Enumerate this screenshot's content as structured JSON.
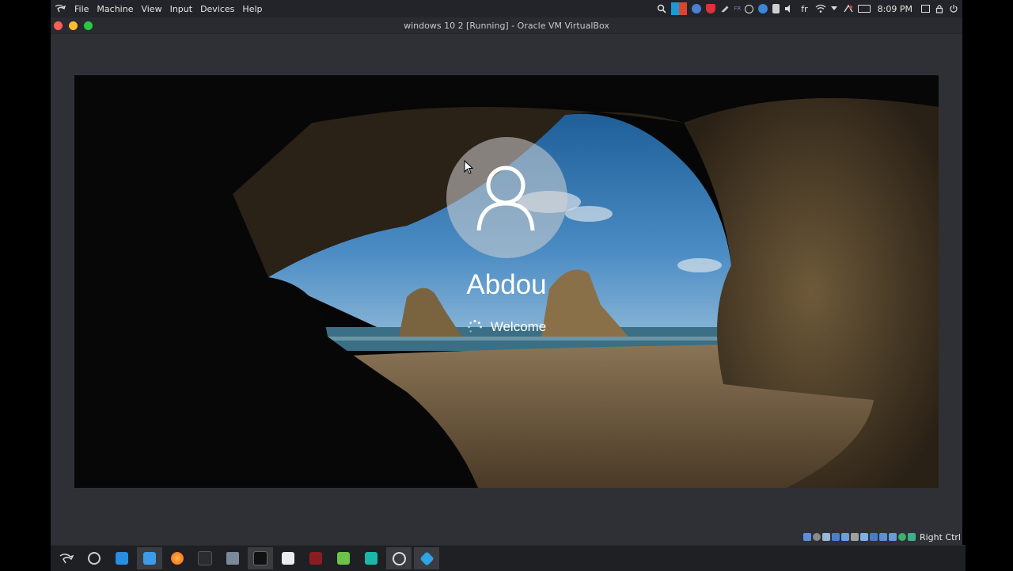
{
  "menu_bar": {
    "items": [
      "File",
      "Machine",
      "View",
      "Input",
      "Devices",
      "Help"
    ],
    "tray": {
      "language": "fr",
      "keyboard_layout": "FR",
      "clock": "8:09 PM"
    }
  },
  "window": {
    "title": "windows 10 2 [Running] - Oracle VM VirtualBox"
  },
  "lock_screen": {
    "user_name": "Abdou",
    "status": "Welcome"
  },
  "status_bar": {
    "host_key": "Right Ctrl"
  },
  "taskbar": {
    "apps": [
      "kali-icon",
      "settings-icon",
      "software-icon",
      "file-manager-icon",
      "firefox-icon",
      "terminal-icon",
      "burp-icon",
      "terminal-icon",
      "notes-icon",
      "tool-icon",
      "android-icon",
      "bolt-icon",
      "obs-icon",
      "virtualbox-icon"
    ]
  },
  "colors": {
    "menu_bar": "#232429",
    "window_bg": "#2e3035",
    "close": "#ff5f57",
    "minimize": "#febc2e",
    "maximize": "#28c840"
  }
}
